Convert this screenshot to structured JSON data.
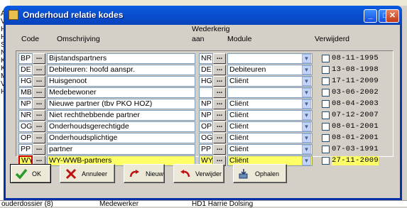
{
  "background": {
    "left_texts": [
      "Ar",
      "Ve",
      "He",
      "He",
      "Sc",
      "Nr",
      "Ko",
      "Ko",
      "Ma",
      "Vr",
      "He"
    ],
    "bottom_texts": [
      "ouderdossier (8)",
      "Medewerker",
      "HD1 Harrie Dolsing"
    ]
  },
  "window": {
    "title": "Onderhoud relatie kodes",
    "minimize_label": "_",
    "maximize_label": "□",
    "close_label": "✕"
  },
  "headers": {
    "code": "Code",
    "omschrijving": "Omschrijving",
    "wederkerig_1": "Wederkerig",
    "wederkerig_2": "aan",
    "module": "Module",
    "verwijderd": "Verwijderd"
  },
  "dots_label": "...",
  "dropdown_glyph": "▼",
  "rows": [
    {
      "code": "BP",
      "omschrijving": "Bijstandspartners",
      "wederkerig": "NR",
      "module": "",
      "date": "08-11-1995"
    },
    {
      "code": "DE",
      "omschrijving": "Debiteuren: hoofd aanspr.",
      "wederkerig": "DE",
      "module": "Debiteuren",
      "date": "13-08-1998"
    },
    {
      "code": "HG",
      "omschrijving": "Huisgenoot",
      "wederkerig": "HG",
      "module": "Cliënt",
      "date": "17-11-2009"
    },
    {
      "code": "MB",
      "omschrijving": "Medebewoner",
      "wederkerig": "",
      "module": "",
      "date": "03-06-2002"
    },
    {
      "code": "NP",
      "omschrijving": "Nieuwe partner (tbv PKO HOZ)",
      "wederkerig": "NP",
      "module": "Cliënt",
      "date": "08-04-2003"
    },
    {
      "code": "NR",
      "omschrijving": "Niet rechthebbende partner",
      "wederkerig": "NP",
      "module": "Cliënt",
      "date": "07-12-2007"
    },
    {
      "code": "OG",
      "omschrijving": "Onderhoudsgerechtigde",
      "wederkerig": "OP",
      "module": "Cliënt",
      "date": "08-01-2001"
    },
    {
      "code": "OP",
      "omschrijving": "Onderhoudsplichtige",
      "wederkerig": "OG",
      "module": "Cliënt",
      "date": "08-01-2001"
    },
    {
      "code": "PP",
      "omschrijving": "partner",
      "wederkerig": "PP",
      "module": "Cliënt",
      "date": "07-03-1991"
    },
    {
      "code": "WY",
      "omschrijving": "WY-WWB-partners",
      "wederkerig": "WY",
      "module": "Cliënt",
      "date": "27-11-2009",
      "selected": true
    }
  ],
  "buttons": {
    "ok": "OK",
    "annuleer": "Annuleer",
    "nieuw": "Nieuw",
    "verwijder": "Verwijder",
    "ophalen": "Ophalen"
  },
  "colors": {
    "selected_row": "#ffff66",
    "title_bar": "#0a5ae0",
    "ok_check": "#2a9a2a",
    "cancel_x": "#c01010"
  }
}
